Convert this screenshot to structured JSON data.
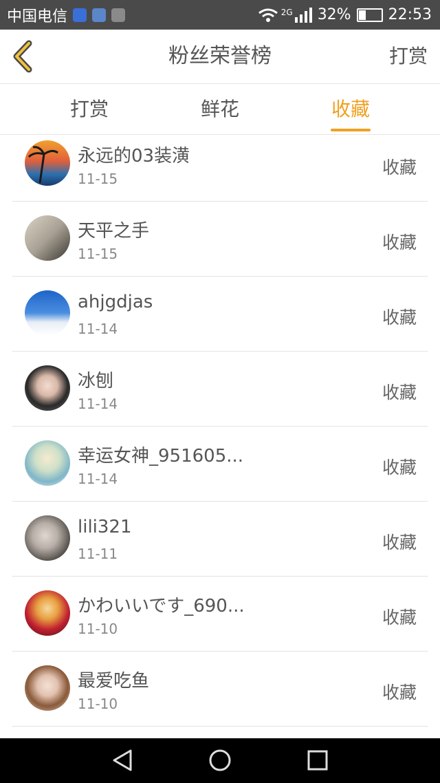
{
  "status_bar": {
    "carrier": "中国电信",
    "network": "2G",
    "battery_percent": "32%",
    "battery_level": 0.32,
    "time": "22:53"
  },
  "header": {
    "title": "粉丝荣誉榜",
    "right_action": "打赏"
  },
  "tabs": [
    {
      "label": "打赏",
      "active": false
    },
    {
      "label": "鲜花",
      "active": false
    },
    {
      "label": "收藏",
      "active": true
    }
  ],
  "colors": {
    "accent": "#f0a020",
    "status_bar": "#4a4a4a",
    "divider": "#e3e3e3"
  },
  "list": [
    {
      "name": "永远的03装潢",
      "date": "11-15",
      "action": "收藏"
    },
    {
      "name": "天平之手",
      "date": "11-15",
      "action": "收藏"
    },
    {
      "name": "ahjgdjas",
      "date": "11-14",
      "action": "收藏"
    },
    {
      "name": "冰刨",
      "date": "11-14",
      "action": "收藏"
    },
    {
      "name": "幸运女神_951605...",
      "date": "11-14",
      "action": "收藏"
    },
    {
      "name": "lili321",
      "date": "11-11",
      "action": "收藏"
    },
    {
      "name": "かわいいです_690...",
      "date": "11-10",
      "action": "收藏"
    },
    {
      "name": "最爱吃鱼",
      "date": "11-10",
      "action": "收藏"
    }
  ]
}
